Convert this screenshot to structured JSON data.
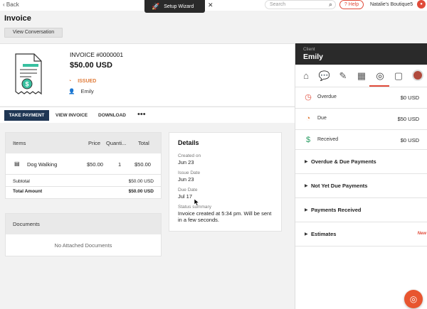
{
  "topbar": {
    "back_label": "Back",
    "wizard_label": "Setup Wizard",
    "search_placeholder": "Search",
    "help_label": "Help",
    "business_name": "Natalie's Boutique5"
  },
  "header": {
    "title": "Invoice",
    "view_conversation": "View Conversation"
  },
  "invoice": {
    "number": "INVOICE #0000001",
    "amount": "$50.00 USD",
    "status": "ISSUED",
    "client": "Emily"
  },
  "actions": {
    "take_payment": "TAKE PAYMENT",
    "view_invoice": "VIEW INVOICE",
    "download": "DOWNLOAD",
    "more": "•••"
  },
  "items": {
    "headers": [
      "Items",
      "Price",
      "Quanti...",
      "Total"
    ],
    "rows": [
      {
        "name": "Dog Walking",
        "price": "$50.00",
        "qty": "1",
        "total": "$50.00"
      }
    ],
    "subtotal_label": "Subtotal",
    "subtotal_value": "$50.00 USD",
    "total_label": "Total Amount",
    "total_value": "$50.00 USD"
  },
  "documents": {
    "title": "Documents",
    "empty": "No Attached Documents"
  },
  "details": {
    "title": "Details",
    "created_label": "Created on",
    "created_value": "Jun 23",
    "issue_label": "Issue Date",
    "issue_value": "Jun 23",
    "due_label": "Due Date",
    "due_value": "Jul 17",
    "status_label": "Status summary",
    "status_value": "Invoice created at 5:34 pm. Will be sent in a few seconds."
  },
  "panel": {
    "sub": "Client",
    "name": "Emily",
    "stats": [
      {
        "label": "Overdue",
        "value": "$0 USD",
        "color": "#e04b3a"
      },
      {
        "label": "Due",
        "value": "$50 USD",
        "color": "#e07b39"
      },
      {
        "label": "Received",
        "value": "$0 USD",
        "color": "#2a9d63"
      }
    ],
    "sections": [
      {
        "label": "Overdue & Due Payments",
        "badge": ""
      },
      {
        "label": "Not Yet Due Payments",
        "badge": ""
      },
      {
        "label": "Payments Received",
        "badge": ""
      },
      {
        "label": "Estimates",
        "badge": "New"
      }
    ]
  },
  "colors": {
    "primary": "#1f3654",
    "accent": "#e04b3a",
    "issued": "#e07b39"
  }
}
